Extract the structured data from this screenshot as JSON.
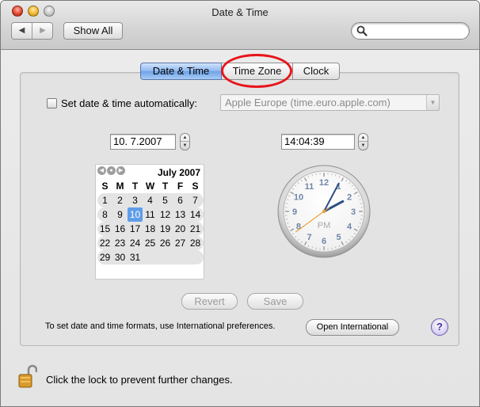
{
  "window": {
    "title": "Date & Time"
  },
  "toolbar": {
    "back_glyph": "◀",
    "forward_glyph": "▶",
    "show_all_label": "Show All",
    "search_placeholder": "",
    "search_icon": "magnifier-icon"
  },
  "tabs": [
    {
      "label": "Date & Time",
      "selected": true
    },
    {
      "label": "Time Zone",
      "selected": false,
      "highlighted": true
    },
    {
      "label": "Clock",
      "selected": false
    }
  ],
  "highlight_color": "#e8141a",
  "auto_set": {
    "label": "Set date & time automatically:",
    "checked": false,
    "server": "Apple Europe (time.euro.apple.com)"
  },
  "date": {
    "value": "10.  7.2007"
  },
  "time": {
    "value": "14:04:39"
  },
  "calendar": {
    "month_label": "July 2007",
    "nav": [
      "◀",
      "●",
      "▶"
    ],
    "weekday_headers": [
      "S",
      "M",
      "T",
      "W",
      "T",
      "F",
      "S"
    ],
    "weeks": [
      [
        "1",
        "2",
        "3",
        "4",
        "5",
        "6",
        "7"
      ],
      [
        "8",
        "9",
        "10",
        "11",
        "12",
        "13",
        "14"
      ],
      [
        "15",
        "16",
        "17",
        "18",
        "19",
        "20",
        "21"
      ],
      [
        "22",
        "23",
        "24",
        "25",
        "26",
        "27",
        "28"
      ],
      [
        "29",
        "30",
        "31",
        "",
        "",
        "",
        ""
      ]
    ],
    "selected_day": "10",
    "selected_color": "#5f9de8"
  },
  "clock": {
    "numbers": [
      "12",
      "1",
      "2",
      "3",
      "4",
      "5",
      "6",
      "7",
      "8",
      "9",
      "10",
      "11"
    ],
    "period": "PM",
    "hour": 14,
    "minute": 4,
    "second": 39,
    "hand_color": "#2d4f86",
    "second_hand_color": "#e9a23b"
  },
  "buttons": {
    "revert": "Revert",
    "save": "Save",
    "open_international": "Open International",
    "help": "?"
  },
  "intl_text": "To set date and time formats, use International preferences.",
  "lock": {
    "text": "Click the lock to prevent further changes.",
    "icon": "padlock-open-icon"
  }
}
